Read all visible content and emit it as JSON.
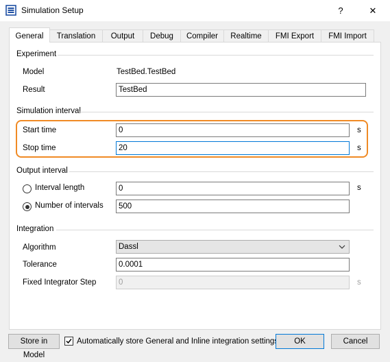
{
  "window": {
    "title": "Simulation Setup",
    "help_label": "?",
    "close_label": "✕"
  },
  "tabs": [
    {
      "label": "General"
    },
    {
      "label": "Translation"
    },
    {
      "label": "Output"
    },
    {
      "label": "Debug"
    },
    {
      "label": "Compiler"
    },
    {
      "label": "Realtime"
    },
    {
      "label": "FMI Export"
    },
    {
      "label": "FMI Import"
    }
  ],
  "experiment": {
    "heading": "Experiment",
    "model_label": "Model",
    "model_value": "TestBed.TestBed",
    "result_label": "Result",
    "result_value": "TestBed"
  },
  "simulation_interval": {
    "heading": "Simulation interval",
    "start_label": "Start time",
    "start_value": "0",
    "start_unit": "s",
    "stop_label": "Stop time",
    "stop_value": "20",
    "stop_unit": "s"
  },
  "output_interval": {
    "heading": "Output interval",
    "interval_length_label": "Interval length",
    "interval_length_value": "0",
    "interval_length_unit": "s",
    "num_intervals_label": "Number of intervals",
    "num_intervals_value": "500",
    "selected": "Number of intervals"
  },
  "integration": {
    "heading": "Integration",
    "algorithm_label": "Algorithm",
    "algorithm_value": "Dassl",
    "tolerance_label": "Tolerance",
    "tolerance_value": "0.0001",
    "fixed_step_label": "Fixed Integrator Step",
    "fixed_step_value": "0",
    "fixed_step_unit": "s"
  },
  "footer": {
    "store_label": "Store in Model",
    "auto_store_label": "Automatically store General and Inline integration settings",
    "auto_store_checked": true,
    "ok_label": "OK",
    "cancel_label": "Cancel"
  },
  "colors": {
    "highlight": "#f08a24",
    "focus": "#0078d7",
    "icon": "#1e4fa3"
  }
}
